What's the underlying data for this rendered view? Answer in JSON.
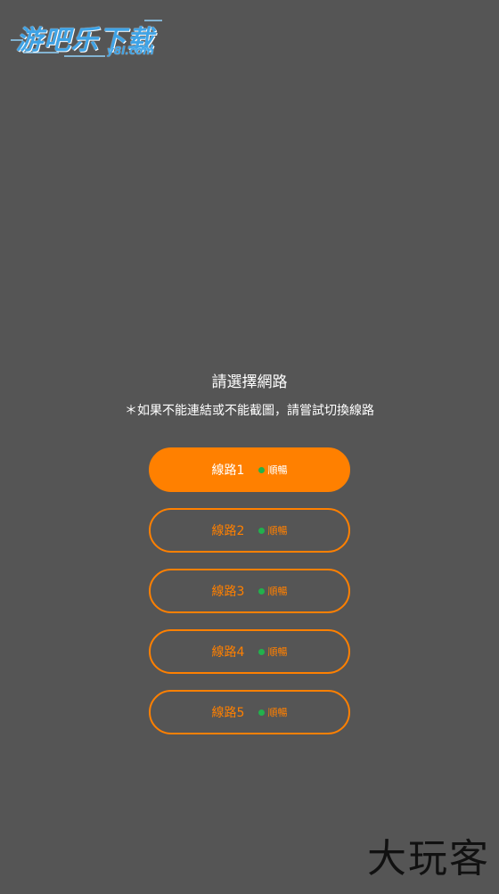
{
  "watermark_top": {
    "main": "游吧乐下载",
    "sub": "y8l.com"
  },
  "watermark_bottom": "大玩客",
  "title": "請選擇網路",
  "subtitle": "＊如果不能連結或不能截圖，請嘗試切換線路",
  "routes": [
    {
      "label": "線路1",
      "status": "順暢",
      "selected": true
    },
    {
      "label": "線路2",
      "status": "順暢",
      "selected": false
    },
    {
      "label": "線路3",
      "status": "順暢",
      "selected": false
    },
    {
      "label": "線路4",
      "status": "順暢",
      "selected": false
    },
    {
      "label": "線路5",
      "status": "順暢",
      "selected": false
    }
  ],
  "colors": {
    "background": "#555555",
    "accent": "#ff8000",
    "status_dot": "#22b14c",
    "watermark_blue": "#3fa3e6"
  }
}
